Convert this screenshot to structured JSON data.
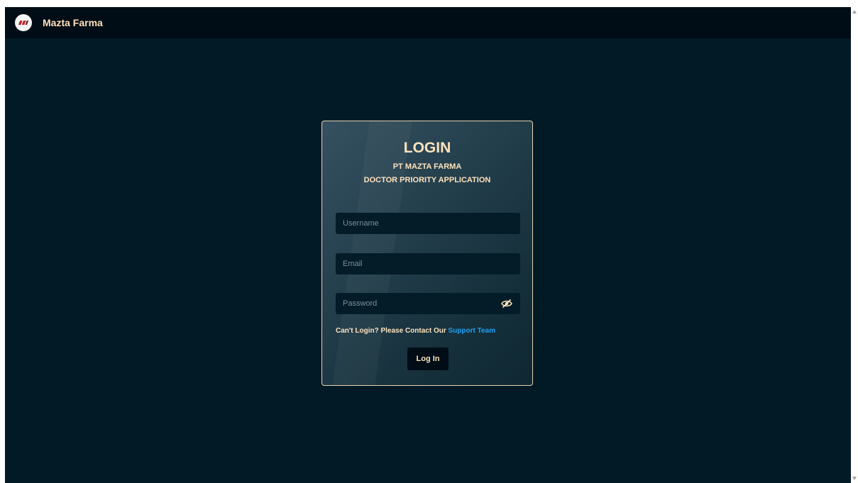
{
  "navbar": {
    "brand": "Mazta Farma",
    "logo_icon": "mazta-farma-logo-icon"
  },
  "login": {
    "title": "LOGIN",
    "subtitle_line1": "PT MAZTA FARMA",
    "subtitle_line2": "DOCTOR PRIORITY APPLICATION",
    "username_placeholder": "Username",
    "email_placeholder": "Email",
    "password_placeholder": "Password",
    "toggle_icon": "eye-slash-icon",
    "help_text": "Can't Login? Please Contact Our ",
    "help_link": "Support Team",
    "submit_label": "Log In"
  },
  "colors": {
    "background": "#011a26",
    "navbar": "#000d16",
    "accent_text": "#ffe2bd",
    "link": "#1da1f2",
    "card_border": "#e8d3b1"
  }
}
